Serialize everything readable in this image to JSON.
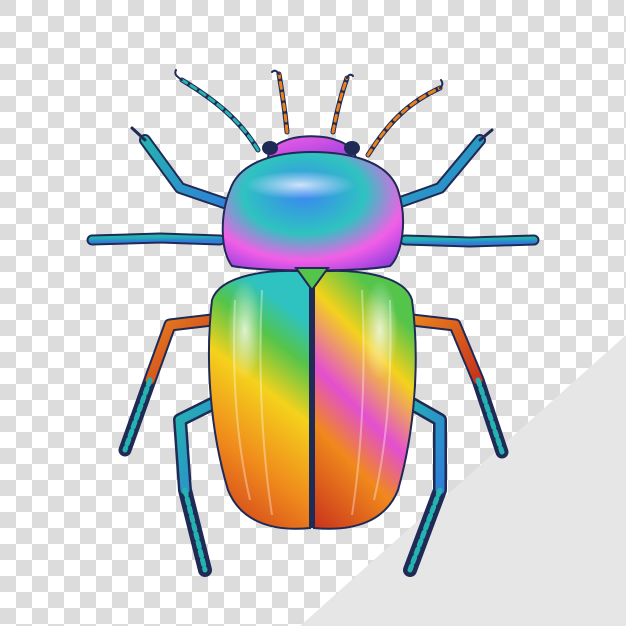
{
  "scene": {
    "subject": "beetle-illustration",
    "colors": {
      "checker_light": "#ffffff",
      "checker_dark": "#dcdcdc",
      "corner_panel": "#e6e6e6",
      "leg_dark": "#1f2a55",
      "leg_blue": "#2f7fd8",
      "leg_teal": "#24b3b0",
      "leg_orange": "#e8801e",
      "shell_red": "#c8321c",
      "shell_orange": "#f0891c",
      "shell_yellow": "#f4d21c",
      "shell_green": "#54c44a",
      "shell_teal": "#2ec3c0",
      "shell_pink": "#e34fd0",
      "pronotum_purple": "#9a3fe0",
      "pronotum_blue": "#3b86f2",
      "pronotum_pink": "#f25fe6"
    }
  }
}
